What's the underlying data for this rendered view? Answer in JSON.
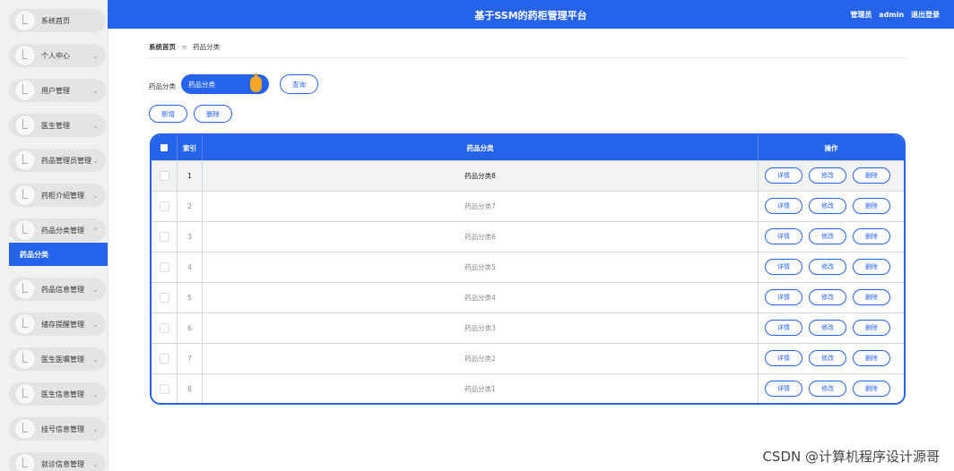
{
  "header": {
    "title": "基于SSM的药柜管理平台",
    "role": "管理员",
    "user": "admin",
    "logout": "退出登录"
  },
  "sidebar": {
    "items": [
      {
        "label": "系统首页",
        "chevron": ""
      },
      {
        "label": "个人中心",
        "chevron": "⌄"
      },
      {
        "label": "用户管理",
        "chevron": "⌄"
      },
      {
        "label": "医生管理",
        "chevron": "⌄"
      },
      {
        "label": "药品管理员管理",
        "chevron": "⌄"
      },
      {
        "label": "药柜介绍管理",
        "chevron": "⌄"
      },
      {
        "label": "药品分类管理",
        "chevron": "^"
      },
      {
        "label": "药品信息管理",
        "chevron": "⌄"
      },
      {
        "label": "储存提醒管理",
        "chevron": "⌄"
      },
      {
        "label": "医生医嘱管理",
        "chevron": "⌄"
      },
      {
        "label": "医生信息管理",
        "chevron": "⌄"
      },
      {
        "label": "挂号信息管理",
        "chevron": "⌄"
      },
      {
        "label": "就诊信息管理",
        "chevron": "⌄"
      }
    ],
    "active_sub": "药品分类"
  },
  "breadcrumb": {
    "home": "系统首页",
    "sep": "≡",
    "current": "药品分类"
  },
  "search": {
    "label": "药品分类",
    "placeholder": "药品分类",
    "query_button": "查询"
  },
  "toolbar": {
    "add_button": "新增",
    "delete_button": "删除"
  },
  "table": {
    "headers": {
      "index": "索引",
      "name": "药品分类",
      "actions": "操作"
    },
    "rows": [
      {
        "index": "1",
        "name": "药品分类8"
      },
      {
        "index": "2",
        "name": "药品分类7"
      },
      {
        "index": "3",
        "name": "药品分类6"
      },
      {
        "index": "4",
        "name": "药品分类5"
      },
      {
        "index": "5",
        "name": "药品分类4"
      },
      {
        "index": "6",
        "name": "药品分类3"
      },
      {
        "index": "7",
        "name": "药品分类2"
      },
      {
        "index": "8",
        "name": "药品分类1"
      }
    ],
    "action_labels": {
      "detail": "详情",
      "edit": "修改",
      "delete": "删除"
    }
  },
  "watermark": "CSDN @计算机程序设计源哥",
  "colors": {
    "accent": "#2563eb",
    "knob": "#f4a623"
  }
}
